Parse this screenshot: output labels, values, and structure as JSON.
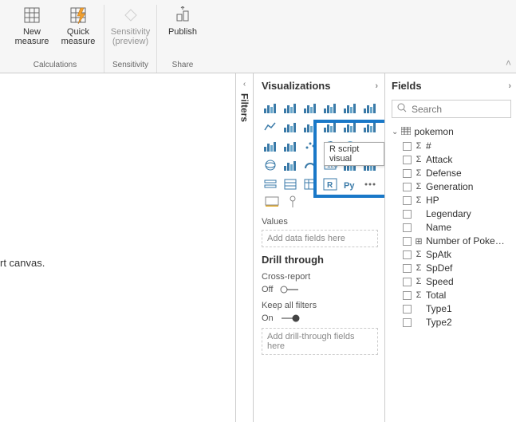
{
  "ribbon": {
    "groups": [
      {
        "name": "Calculations",
        "buttons": [
          {
            "id": "new-measure",
            "label_line1": "New",
            "label_line2": "measure",
            "icon": "grid"
          },
          {
            "id": "quick-measure",
            "label_line1": "Quick",
            "label_line2": "measure",
            "icon": "grid-bolt"
          }
        ]
      },
      {
        "name": "Sensitivity",
        "buttons": [
          {
            "id": "sensitivity",
            "label_line1": "Sensitivity",
            "label_line2": "(preview)",
            "icon": "diamond",
            "disabled": true
          }
        ]
      },
      {
        "name": "Share",
        "buttons": [
          {
            "id": "publish",
            "label_line1": "Publish",
            "label_line2": "",
            "icon": "publish"
          }
        ]
      }
    ]
  },
  "canvas": {
    "placeholder_text": "rt canvas."
  },
  "filters": {
    "label": "Filters"
  },
  "viz": {
    "title": "Visualizations",
    "tooltip": "R script visual",
    "values_label": "Values",
    "values_placeholder": "Add data fields here",
    "drill_title": "Drill through",
    "cross_report_label": "Cross-report",
    "cross_report_value": "Off",
    "keep_filters_label": "Keep all filters",
    "keep_filters_value": "On",
    "drill_placeholder": "Add drill-through fields here",
    "icons": [
      "stacked-bar",
      "stacked-col",
      "clustered-bar",
      "clustered-col",
      "100-bar",
      "100-col",
      "line",
      "area",
      "stacked-area",
      "line-col",
      "line-col2",
      "ribbon",
      "waterfall",
      "funnel",
      "scatter",
      "pie",
      "donut",
      "treemap",
      "map",
      "filled-map",
      "gauge",
      "card",
      "multi-card",
      "kpi",
      "slicer",
      "table",
      "matrix",
      "r-visual",
      "python-visual",
      "more"
    ]
  },
  "fields": {
    "title": "Fields",
    "search_placeholder": "Search",
    "table": {
      "name": "pokemon",
      "columns": [
        {
          "name": "#",
          "agg": true
        },
        {
          "name": "Attack",
          "agg": true
        },
        {
          "name": "Defense",
          "agg": true
        },
        {
          "name": "Generation",
          "agg": true
        },
        {
          "name": "HP",
          "agg": true
        },
        {
          "name": "Legendary",
          "agg": false
        },
        {
          "name": "Name",
          "agg": false
        },
        {
          "name": "Number of Poke…",
          "agg": true,
          "icon": "calc"
        },
        {
          "name": "SpAtk",
          "agg": true
        },
        {
          "name": "SpDef",
          "agg": true
        },
        {
          "name": "Speed",
          "agg": true
        },
        {
          "name": "Total",
          "agg": true
        },
        {
          "name": "Type1",
          "agg": false
        },
        {
          "name": "Type2",
          "agg": false
        }
      ]
    }
  }
}
